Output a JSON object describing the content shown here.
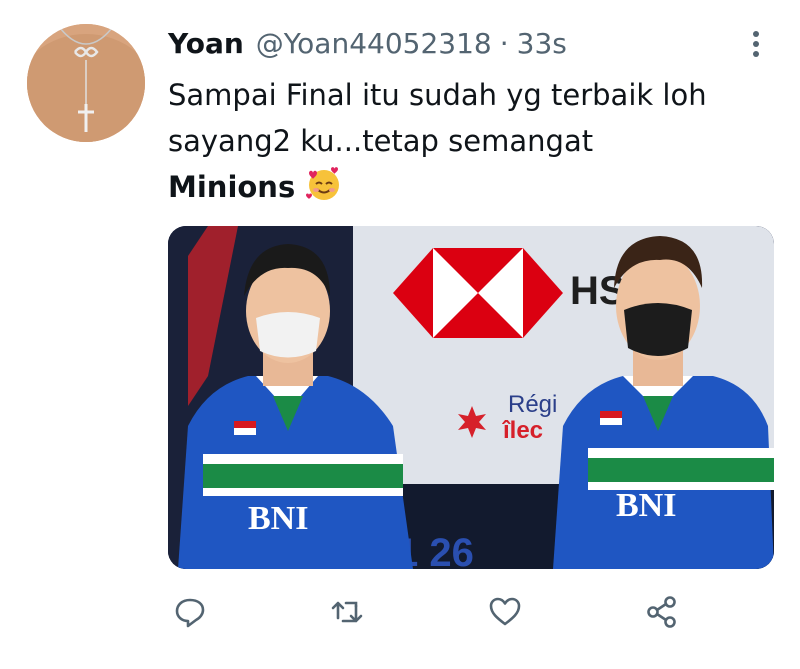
{
  "tweet": {
    "display_name": "Yoan",
    "handle": "@Yoan44052318",
    "separator": "·",
    "time": "33s",
    "text_lines": [
      "Sampai Final itu sudah yg terbaik loh",
      "sayang2 ku...tetap semangat"
    ],
    "text_bold": "Minions",
    "emoji": "smiling-face-with-hearts"
  },
  "media": {
    "sponsor_text": "HS",
    "region_text_1": "Régi",
    "region_text_2": "îlec",
    "jersey_brand": "BNI",
    "scoreboard_text": "1 26"
  },
  "actions": [
    {
      "name": "reply",
      "icon": "reply-icon"
    },
    {
      "name": "retweet",
      "icon": "retweet-icon"
    },
    {
      "name": "like",
      "icon": "heart-icon"
    },
    {
      "name": "share",
      "icon": "share-icon"
    }
  ],
  "colors": {
    "text": "#0f1419",
    "secondary": "#536471",
    "icon": "#536471"
  }
}
